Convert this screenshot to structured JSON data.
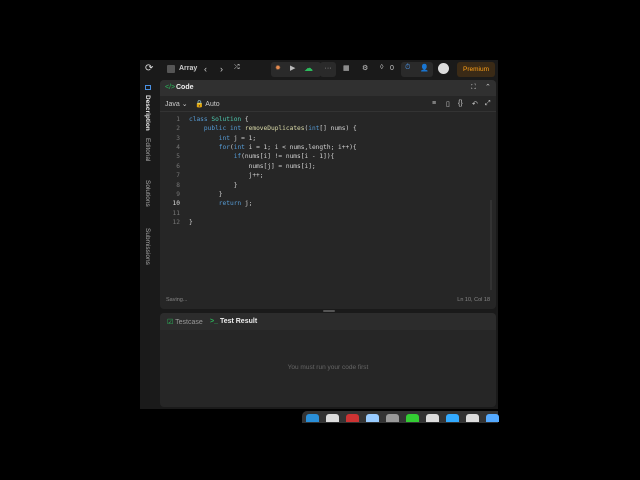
{
  "topbar": {
    "problem_list": "Array",
    "streak": "0",
    "premium": "Premium"
  },
  "sidebar": {
    "tabs": [
      "Description",
      "Editorial",
      "Solutions",
      "Submissions"
    ]
  },
  "editor": {
    "title": "Code",
    "language": "Java",
    "autosave": "Auto",
    "status": "Saving...",
    "cursor": "Ln 10, Col 18",
    "lines": [
      [
        [
          "class ",
          "k"
        ],
        [
          "Solution",
          "c"
        ],
        [
          " {",
          "t"
        ]
      ],
      [
        [
          "    public ",
          "k"
        ],
        [
          "int ",
          "k"
        ],
        [
          "removeDuplicates",
          "f"
        ],
        [
          "(",
          "t"
        ],
        [
          "int",
          "k"
        ],
        [
          "[] nums) {",
          "t"
        ]
      ],
      [
        [
          "        int ",
          "k"
        ],
        [
          "j = 1;",
          "t"
        ]
      ],
      [
        [
          "        for",
          "k"
        ],
        [
          "(",
          "t"
        ],
        [
          "int ",
          "k"
        ],
        [
          "i = 1; i < nums,length; i++){",
          "t"
        ]
      ],
      [
        [
          "            if",
          "k"
        ],
        [
          "(nums[i] != nums[i - 1]){",
          "t"
        ]
      ],
      [
        [
          "                nums[j] = nums[i];",
          "t"
        ]
      ],
      [
        [
          "                j++;",
          "t"
        ]
      ],
      [
        [
          "            }",
          "t"
        ]
      ],
      [
        [
          "        }",
          "t"
        ]
      ],
      [
        [
          "        return ",
          "k"
        ],
        [
          "j;",
          "t"
        ]
      ],
      [
        [
          "",
          "t"
        ]
      ],
      [
        [
          "}",
          "t"
        ]
      ]
    ]
  },
  "bottom": {
    "tab_testcase": "Testcase",
    "tab_result": "Test Result",
    "message": "You must run your code first"
  },
  "colors": {
    "accent": "#2cbb5d",
    "premium": "#ffa116"
  }
}
